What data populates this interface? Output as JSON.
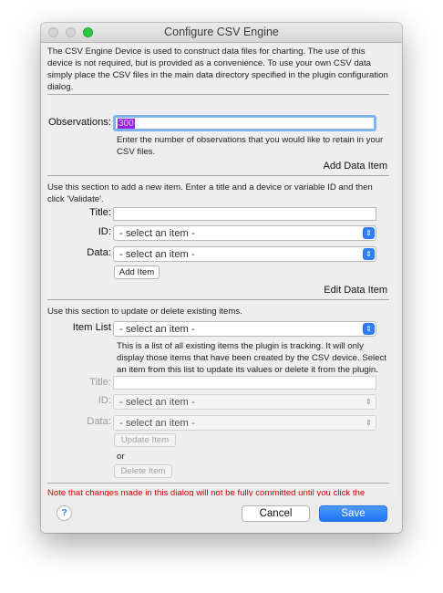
{
  "window": {
    "title": "Configure CSV Engine"
  },
  "intro": "The CSV Engine Device is used to construct data files for charting.  The use of this device is not required, but is provided as a convenience. To use your own CSV data simply place the CSV files in the main data directory specified in the plugin configuration dialog.",
  "observations": {
    "label": "Observations:",
    "value": "300",
    "help": "Enter the number of observations that you would like to retain in your CSV files."
  },
  "add_section": {
    "title": "Add Data Item",
    "description": "Use this section to add a new item. Enter a title and a device or variable ID and then click 'Validate'.",
    "title_label": "Title:",
    "title_value": "",
    "id_label": "ID:",
    "id_value": "- select an item -",
    "data_label": "Data:",
    "data_value": "- select an item -",
    "add_button": "Add Item"
  },
  "edit_section": {
    "title": "Edit Data Item",
    "description": "Use this section to update or delete existing items.",
    "item_list_label": "Item List",
    "item_list_value": "- select an item -",
    "item_list_help": "This is a list of all existing items the plugin is tracking.  It will only display those items that have been created by the CSV device.  Select an item from this list to update its values or delete it from the plugin.",
    "title_label": "Title:",
    "title_value": "",
    "id_label": "ID:",
    "id_value": "- select an item -",
    "data_label": "Data:",
    "data_value": "- select an item -",
    "update_button": "Update Item",
    "or_text": "or",
    "delete_button": "Delete Item"
  },
  "note": "Note that changes made in this dialog will not be fully committed until you click the \"Save\" button.",
  "footer": {
    "help_glyph": "?",
    "cancel_label": "Cancel",
    "save_label": "Save"
  },
  "colors": {
    "accent": "#2d7ef7",
    "warning": "#d40000",
    "selection": "#9a1ee0"
  }
}
